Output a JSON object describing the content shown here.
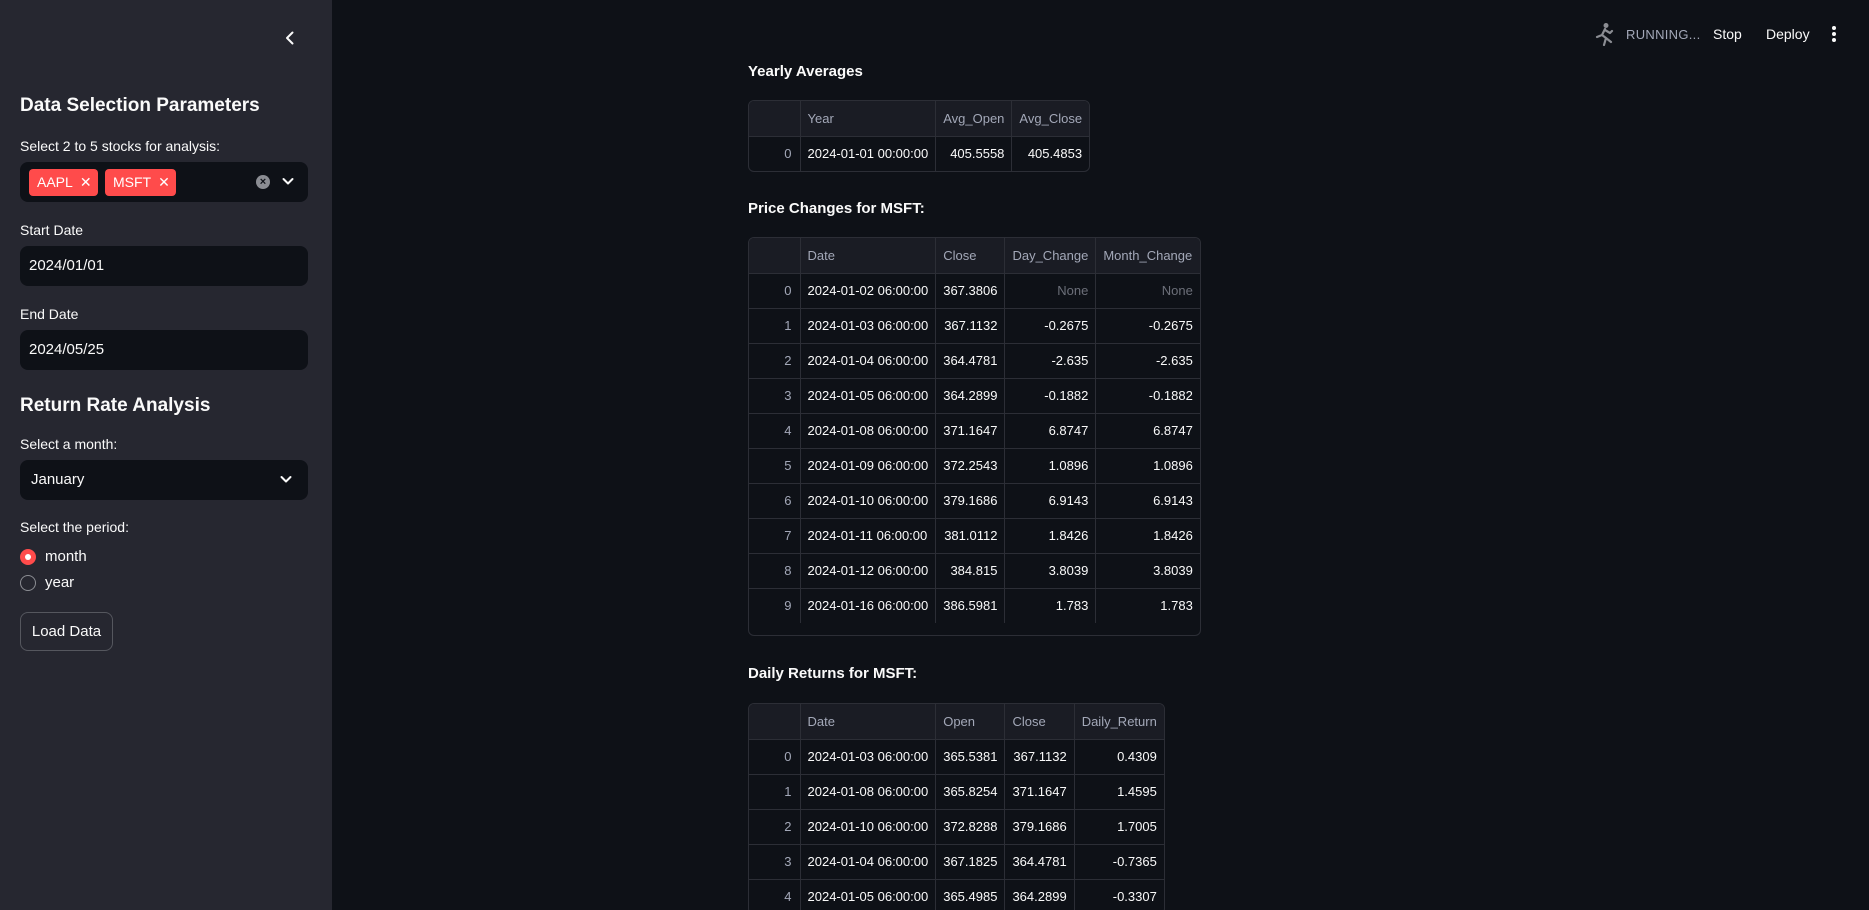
{
  "sidebar": {
    "heading": "Data Selection Parameters",
    "stocks_label": "Select 2 to 5 stocks for analysis:",
    "selected_stocks": [
      "AAPL",
      "MSFT"
    ],
    "start_date_label": "Start Date",
    "start_date": "2024/01/01",
    "end_date_label": "End Date",
    "end_date": "2024/05/25",
    "return_heading": "Return Rate Analysis",
    "month_label": "Select a month:",
    "month_value": "January",
    "period_label": "Select the period:",
    "period_options": [
      "month",
      "year"
    ],
    "period_selected": "month",
    "load_button": "Load Data"
  },
  "header": {
    "status": "RUNNING...",
    "stop": "Stop",
    "deploy": "Deploy"
  },
  "yearly": {
    "title": "Yearly Averages",
    "columns": [
      "",
      "Year",
      "Avg_Open",
      "Avg_Close"
    ],
    "rows": [
      [
        "0",
        "2024-01-01 00:00:00",
        "405.5558",
        "405.4853"
      ]
    ]
  },
  "price_changes": {
    "title": "Price Changes for MSFT:",
    "columns": [
      "",
      "Date",
      "Close",
      "Day_Change",
      "Month_Change"
    ],
    "rows": [
      [
        "0",
        "2024-01-02 06:00:00",
        "367.3806",
        "None",
        "None"
      ],
      [
        "1",
        "2024-01-03 06:00:00",
        "367.1132",
        "-0.2675",
        "-0.2675"
      ],
      [
        "2",
        "2024-01-04 06:00:00",
        "364.4781",
        "-2.635",
        "-2.635"
      ],
      [
        "3",
        "2024-01-05 06:00:00",
        "364.2899",
        "-0.1882",
        "-0.1882"
      ],
      [
        "4",
        "2024-01-08 06:00:00",
        "371.1647",
        "6.8747",
        "6.8747"
      ],
      [
        "5",
        "2024-01-09 06:00:00",
        "372.2543",
        "1.0896",
        "1.0896"
      ],
      [
        "6",
        "2024-01-10 06:00:00",
        "379.1686",
        "6.9143",
        "6.9143"
      ],
      [
        "7",
        "2024-01-11 06:00:00",
        "381.0112",
        "1.8426",
        "1.8426"
      ],
      [
        "8",
        "2024-01-12 06:00:00",
        "384.815",
        "3.8039",
        "3.8039"
      ],
      [
        "9",
        "2024-01-16 06:00:00",
        "386.5981",
        "1.783",
        "1.783"
      ]
    ]
  },
  "daily_returns": {
    "title": "Daily Returns for MSFT:",
    "columns": [
      "",
      "Date",
      "Open",
      "Close",
      "Daily_Return"
    ],
    "rows": [
      [
        "0",
        "2024-01-03 06:00:00",
        "365.5381",
        "367.1132",
        "0.4309"
      ],
      [
        "1",
        "2024-01-08 06:00:00",
        "365.8254",
        "371.1647",
        "1.4595"
      ],
      [
        "2",
        "2024-01-10 06:00:00",
        "372.8288",
        "379.1686",
        "1.7005"
      ],
      [
        "3",
        "2024-01-04 06:00:00",
        "367.1825",
        "364.4781",
        "-0.7365"
      ],
      [
        "4",
        "2024-01-05 06:00:00",
        "365.4985",
        "364.2899",
        "-0.3307"
      ]
    ]
  }
}
